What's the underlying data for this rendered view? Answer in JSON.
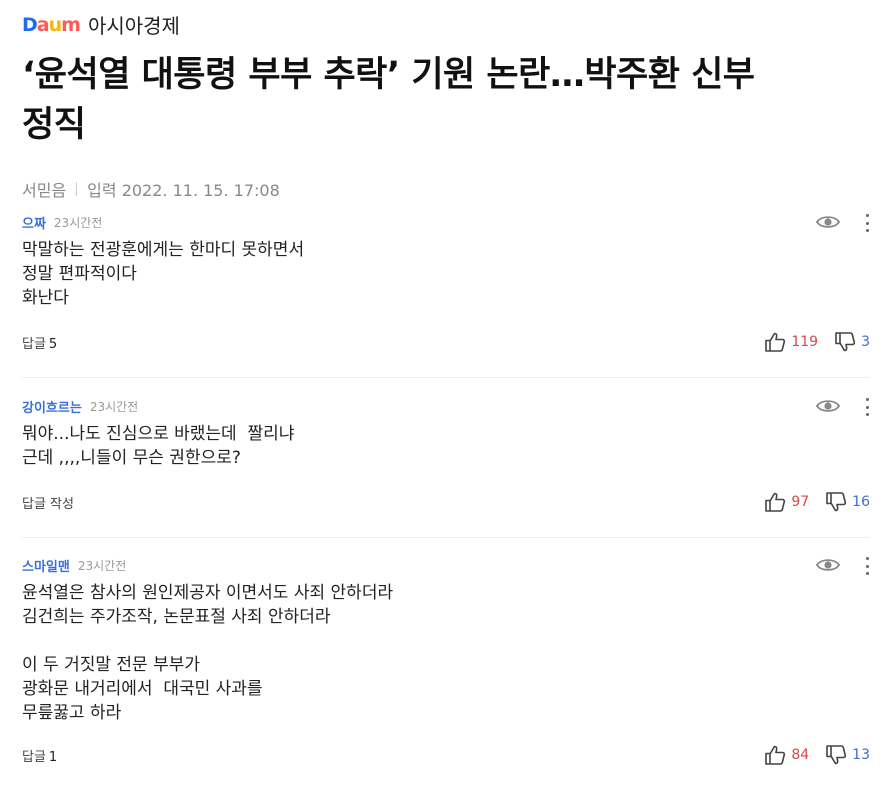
{
  "header": {
    "logo_letters": [
      "D",
      "a",
      "u",
      "m"
    ],
    "press": "아시아경제"
  },
  "article": {
    "title_line1": "‘윤석열 대통령 부부 추락’ 기원 논란…박주환 신부",
    "title_line2": "정직",
    "author": "서믿음",
    "date": "입력 2022. 11. 15. 17:08"
  },
  "comments": [
    {
      "nick": "으짜",
      "time": "23시간전",
      "lines": [
        "막말하는 전광훈에게는 한마디 못하면서",
        "정말 편파적이다",
        "화난다"
      ],
      "reply_label": "답글",
      "reply_count": "5",
      "likes": "119",
      "dislikes": "3"
    },
    {
      "nick": "강이흐르는",
      "time": "23시간전",
      "lines": [
        "뭐야...나도 진심으로 바랬는데  짤리냐",
        "근데 ,,,,니들이 무슨 권한으로?"
      ],
      "reply_label": "답글 작성",
      "reply_count": "",
      "likes": "97",
      "dislikes": "16"
    },
    {
      "nick": "스마일맨",
      "time": "23시간전",
      "lines": [
        "윤석열은 참사의 원인제공자 이면서도 사죄 안하더라",
        "김건희는 주가조작, 논문표절 사죄 안하더라",
        "",
        "이 두 거짓말 전문 부부가",
        "광화문 내거리에서  대국민 사과를",
        "무릎꿇고 하라"
      ],
      "reply_label": "답글",
      "reply_count": "1",
      "likes": "84",
      "dislikes": "13"
    }
  ],
  "colors": {
    "accent": "#3a6fd8",
    "like": "#d84a4a",
    "logo_d": "#1e6bf0",
    "logo_a": "#ff5a5a",
    "logo_u": "#ffb400",
    "logo_m": "#ff5a5a"
  },
  "icons": {
    "view": "eye-icon",
    "more": "more-vertical-icon",
    "like": "thumbs-up-icon",
    "dislike": "thumbs-down-icon"
  }
}
